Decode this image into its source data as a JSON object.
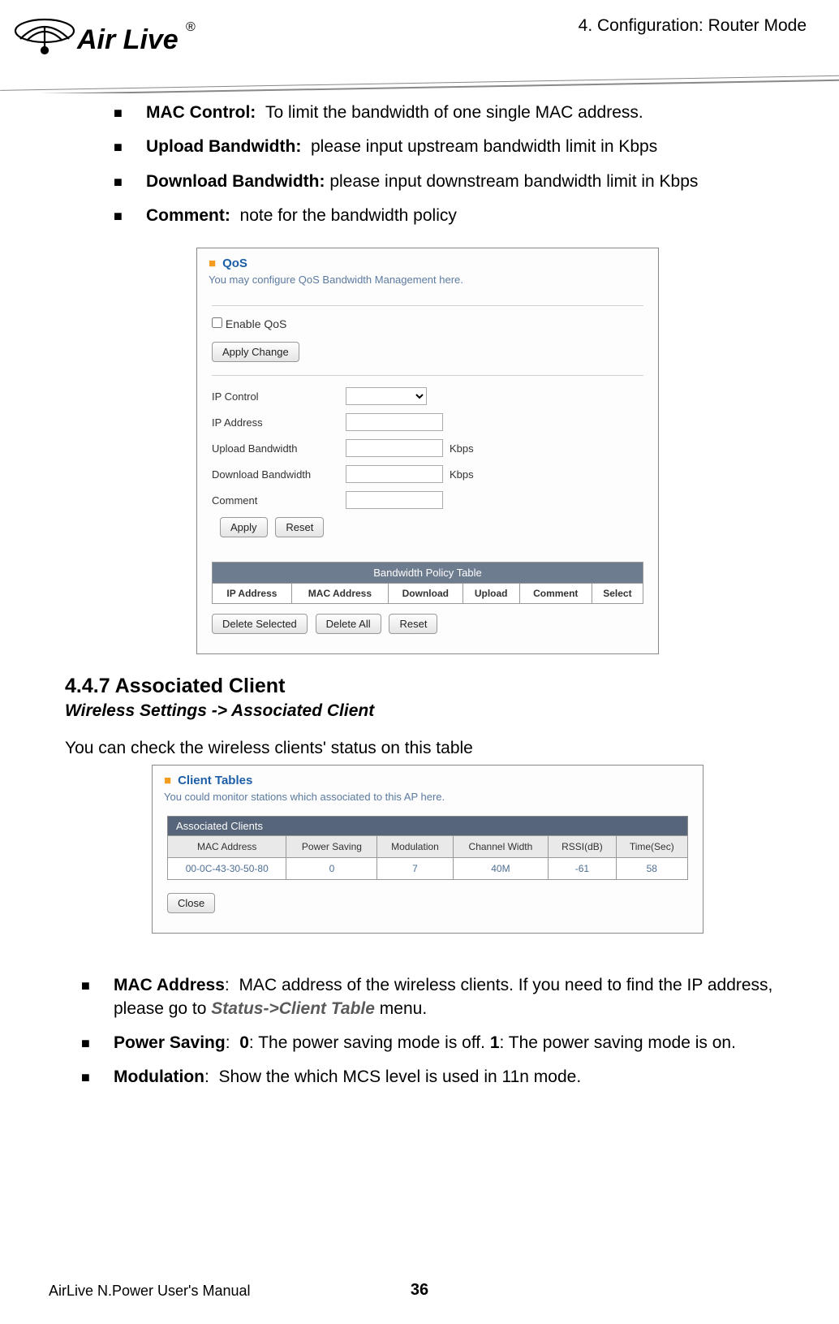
{
  "header": {
    "logo_text": "Air Live",
    "chapter": "4. Configuration: Router Mode"
  },
  "bullets1": [
    {
      "label": "MAC Control:",
      "text": "To limit the bandwidth of one single MAC address."
    },
    {
      "label": "Upload Bandwidth:",
      "text": "please input upstream bandwidth limit in Kbps"
    },
    {
      "label": "Download Bandwidth:",
      "text": "please input downstream bandwidth limit in Kbps"
    },
    {
      "label": "Comment:",
      "text": "note for the bandwidth policy"
    }
  ],
  "qos": {
    "title": "QoS",
    "desc": "You may configure QoS Bandwidth Management here.",
    "enable_label": "Enable QoS",
    "apply_change": "Apply Change",
    "rows": {
      "control": "IP Control",
      "ip": "IP Address",
      "up": "Upload Bandwidth",
      "down": "Download Bandwidth",
      "comment": "Comment"
    },
    "unit": "Kbps",
    "apply": "Apply",
    "reset": "Reset",
    "table_title": "Bandwidth Policy Table",
    "cols": {
      "ip": "IP Address",
      "mac": "MAC Address",
      "down": "Download",
      "up": "Upload",
      "comment": "Comment",
      "select": "Select"
    },
    "del_sel": "Delete Selected",
    "del_all": "Delete All"
  },
  "section": {
    "title": "4.4.7 Associated Client",
    "sub": "Wireless Settings -> Associated Client",
    "text": "You can check the wireless clients' status on this table"
  },
  "clients": {
    "title": "Client Tables",
    "desc": "You could monitor stations which associated to this AP here.",
    "table_title": "Associated Clients",
    "cols": {
      "mac": "MAC Address",
      "ps": "Power Saving",
      "mod": "Modulation",
      "ch": "Channel Width",
      "rssi": "RSSI(dB)",
      "time": "Time(Sec)"
    },
    "row": {
      "mac": "00-0C-43-30-50-80",
      "ps": "0",
      "mod": "7",
      "ch": "40M",
      "rssi": "-61",
      "time": "58"
    },
    "close": "Close"
  },
  "bullets2": [
    {
      "label": "MAC Address",
      "sep": ":",
      "text": "MAC address of the wireless clients.  If you need to find the IP address, please go to ",
      "link": "Status->Client Table",
      "text2": " menu."
    },
    {
      "label": "Power Saving",
      "sep": ":",
      "text": "0",
      "mid": ": The power saving mode is off.  ",
      "text1b": "1",
      "text2": ": The power saving mode is on."
    },
    {
      "label": "Modulation",
      "sep": ":",
      "text": "Show the which MCS level is used in 11n mode."
    }
  ],
  "footer": {
    "manual": "AirLive N.Power User's Manual",
    "page": "36"
  }
}
